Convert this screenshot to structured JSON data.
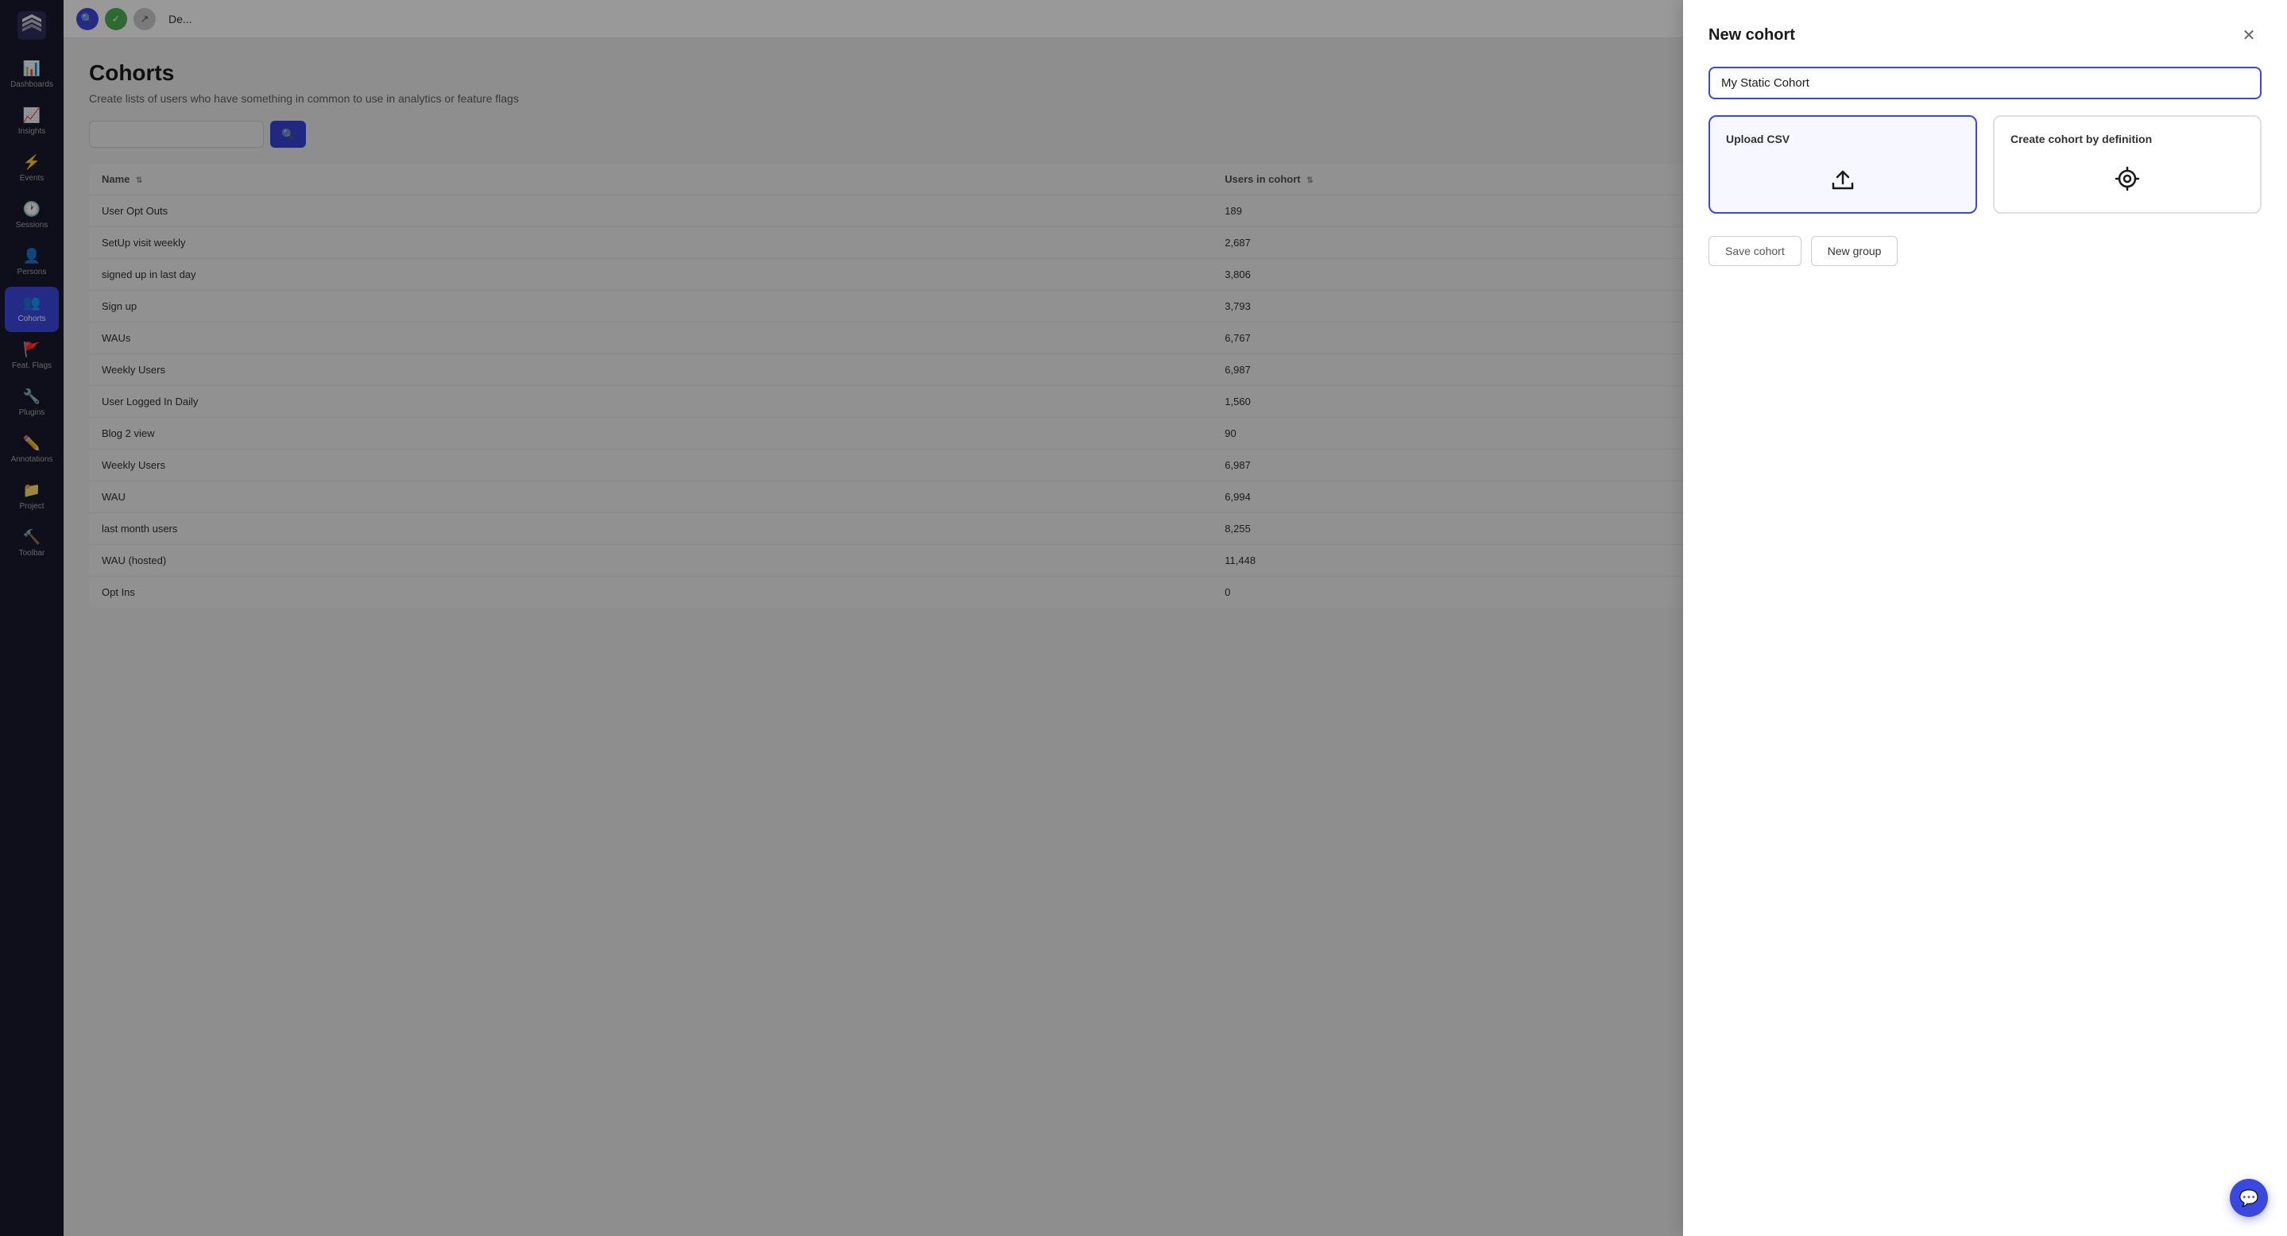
{
  "sidebar": {
    "items": [
      {
        "id": "dashboards",
        "label": "Dashboards",
        "icon": "📊",
        "active": false
      },
      {
        "id": "insights",
        "label": "Insights",
        "icon": "📈",
        "active": false
      },
      {
        "id": "events",
        "label": "Events",
        "icon": "⚡",
        "active": false
      },
      {
        "id": "sessions",
        "label": "Sessions",
        "icon": "🕐",
        "active": false
      },
      {
        "id": "persons",
        "label": "Persons",
        "icon": "👤",
        "active": false
      },
      {
        "id": "cohorts",
        "label": "Cohorts",
        "icon": "👥",
        "active": true
      },
      {
        "id": "feat-flags",
        "label": "Feat. Flags",
        "icon": "🚩",
        "active": false
      },
      {
        "id": "plugins",
        "label": "Plugins",
        "icon": "🔧",
        "active": false
      },
      {
        "id": "annotations",
        "label": "Annotations",
        "icon": "✏️",
        "active": false
      },
      {
        "id": "project",
        "label": "Project",
        "icon": "📁",
        "active": false
      },
      {
        "id": "toolbar",
        "label": "Toolbar",
        "icon": "🔨",
        "active": false
      }
    ]
  },
  "topbar": {
    "title": "De...",
    "btn1_title": "Search",
    "btn2_title": "Confirm",
    "btn3_title": "Back"
  },
  "page": {
    "title": "Cohorts",
    "subtitle": "Create lists of users who have something in common to use in analytics or feature flags",
    "search_placeholder": "",
    "table": {
      "columns": [
        "Name",
        "Users in cohort"
      ],
      "rows": [
        {
          "name": "User Opt Outs",
          "users": "189"
        },
        {
          "name": "SetUp visit weekly",
          "users": "2,687"
        },
        {
          "name": "signed up in last day",
          "users": "3,806"
        },
        {
          "name": "Sign up",
          "users": "3,793"
        },
        {
          "name": "WAUs",
          "users": "6,767"
        },
        {
          "name": "Weekly Users",
          "users": "6,987"
        },
        {
          "name": "User Logged In Daily",
          "users": "1,560"
        },
        {
          "name": "Blog 2 view",
          "users": "90"
        },
        {
          "name": "Weekly Users",
          "users": "6,987"
        },
        {
          "name": "WAU",
          "users": "6,994"
        },
        {
          "name": "last month users",
          "users": "8,255"
        },
        {
          "name": "WAU (hosted)",
          "users": "11,448"
        },
        {
          "name": "Opt Ins",
          "users": "0"
        }
      ]
    }
  },
  "modal": {
    "title": "New cohort",
    "cohort_name_value": "My Static Cohort",
    "cohort_name_placeholder": "My Static Cohort",
    "option1": {
      "title": "Upload CSV",
      "selected": true
    },
    "option2": {
      "title": "Create cohort by definition",
      "selected": false
    },
    "save_btn_label": "Save cohort",
    "new_group_btn_label": "New group"
  }
}
